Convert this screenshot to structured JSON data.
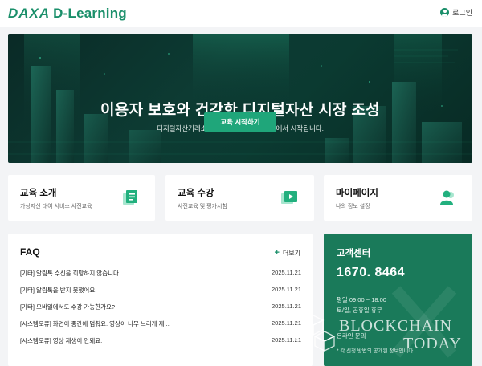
{
  "header": {
    "logo_brand": "DAXA",
    "logo_text": "D-Learning",
    "login_label": "로그인"
  },
  "hero": {
    "title": "이용자 보호와 건강한 디지털자산 시장 조성",
    "subtitle": "디지털자산거래소 공동협의체 D-Learning에서 시작됩니다.",
    "button_label": "교육 시작하기"
  },
  "cards": [
    {
      "title": "교육 소개",
      "subtitle": "가상자산 대여 서비스 사전교육",
      "icon": "document-icon"
    },
    {
      "title": "교육 수강",
      "subtitle": "사전교육 및 평가시험",
      "icon": "video-icon"
    },
    {
      "title": "마이페이지",
      "subtitle": "나의 정보 설정",
      "icon": "user-icon"
    }
  ],
  "faq": {
    "title": "FAQ",
    "more_label": "더보기",
    "items": [
      {
        "question": "[기타] 알림톡 수신을 희망하지 않습니다.",
        "date": "2025.11.21"
      },
      {
        "question": "[기타] 알림톡을 받지 못했어요.",
        "date": "2025.11.21"
      },
      {
        "question": "[기타] 모바일에서도 수강 가능한가요?",
        "date": "2025.11.21"
      },
      {
        "question": "[시스템오류] 화면이 중간에 멈춰요. 영상이 너무 느리게 재...",
        "date": "2025.11.21"
      },
      {
        "question": "[시스템오류] 영상 재생이 안돼요.",
        "date": "2025.11.21"
      }
    ]
  },
  "customer_center": {
    "title": "고객센터",
    "phone": "1670. 8464",
    "hours_weekday": "평일 09:00 ~ 18:00",
    "hours_closed": "토/일, 공휴일 휴무",
    "inquiry_label": "온라인 문의",
    "note": "* 각 신청 방법의 공개된 정보입니다."
  },
  "watermark": {
    "line1": "BLOCKCHAIN",
    "line2": "TODAY"
  },
  "colors": {
    "brand_green": "#1a8f6a",
    "cs_green": "#1a7a5a",
    "button_green": "#1fa67a"
  }
}
